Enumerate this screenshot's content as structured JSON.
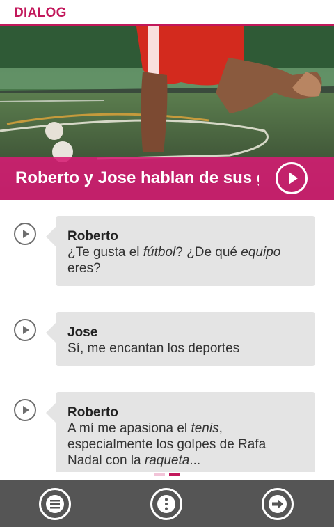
{
  "app_bar": {
    "title": "DIALOG"
  },
  "hero": {
    "banner_title": "Roberto y Jose hablan de sus gustos"
  },
  "messages": [
    {
      "speaker": "Roberto",
      "parts": [
        {
          "t": "¿Te gusta el "
        },
        {
          "t": "fútbol",
          "i": true
        },
        {
          "t": "? ¿De qué "
        },
        {
          "t": "equipo",
          "i": true
        },
        {
          "t": " eres?"
        }
      ]
    },
    {
      "speaker": "Jose",
      "parts": [
        {
          "t": "Sí, me encantan los deportes"
        }
      ]
    },
    {
      "speaker": "Roberto",
      "parts": [
        {
          "t": "A mí me apasiona el "
        },
        {
          "t": "tenis",
          "i": true
        },
        {
          "t": ", especialmente los golpes de Rafa Nadal con la "
        },
        {
          "t": "raqueta",
          "i": true
        },
        {
          "t": "..."
        }
      ]
    }
  ],
  "pager": {
    "pages": 2,
    "current": 2
  },
  "bottom_bar": {
    "buttons": [
      "menu-icon",
      "more-vertical-icon",
      "next-arrow-icon"
    ]
  },
  "colors": {
    "accent": "#c2185b",
    "banner": "#d61b73",
    "bubble": "#e4e4e4",
    "bottom_bar": "#555555"
  }
}
